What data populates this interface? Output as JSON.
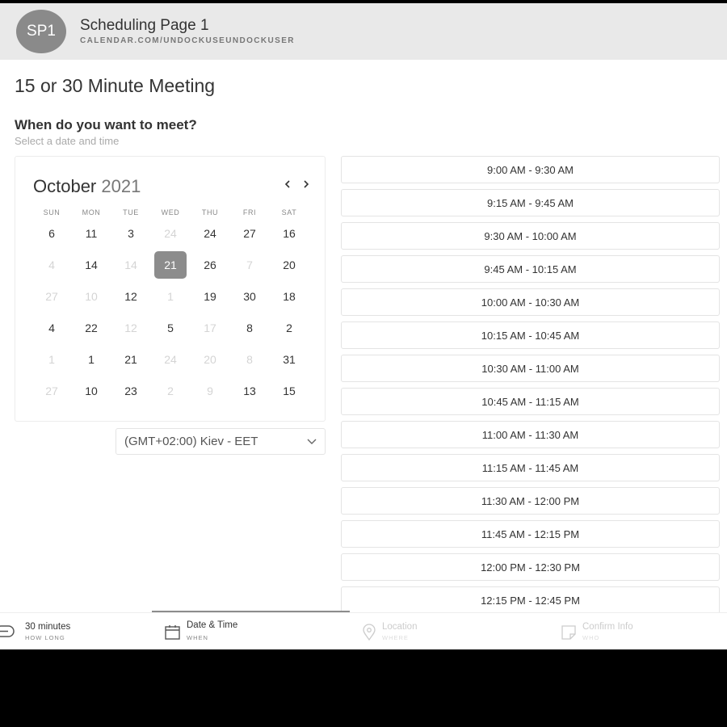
{
  "header": {
    "avatar_initials": "SP1",
    "page_name": "Scheduling Page 1",
    "page_url": "CALENDAR.COM/UNDOCKUSEUNDOCKUSER"
  },
  "meeting_title": "15 or 30 Minute Meeting",
  "question": "When do you want to meet?",
  "subtitle": "Select a date and time",
  "calendar": {
    "month": "October",
    "year": "2021",
    "weekdays": [
      "SUN",
      "MON",
      "TUE",
      "WED",
      "THU",
      "FRI",
      "SAT"
    ],
    "selected_day": "21",
    "weeks": [
      [
        {
          "d": "6",
          "on": true
        },
        {
          "d": "11",
          "on": true
        },
        {
          "d": "3",
          "on": true
        },
        {
          "d": "24",
          "on": false
        },
        {
          "d": "24",
          "on": true
        },
        {
          "d": "27",
          "on": true
        },
        {
          "d": "16",
          "on": true
        }
      ],
      [
        {
          "d": "4",
          "on": false
        },
        {
          "d": "14",
          "on": true
        },
        {
          "d": "14",
          "on": false
        },
        {
          "d": "21",
          "on": true,
          "selected": true
        },
        {
          "d": "26",
          "on": true
        },
        {
          "d": "7",
          "on": false
        },
        {
          "d": "20",
          "on": true
        }
      ],
      [
        {
          "d": "27",
          "on": false
        },
        {
          "d": "10",
          "on": false
        },
        {
          "d": "12",
          "on": true
        },
        {
          "d": "1",
          "on": false
        },
        {
          "d": "19",
          "on": true
        },
        {
          "d": "30",
          "on": true
        },
        {
          "d": "18",
          "on": true
        }
      ],
      [
        {
          "d": "4",
          "on": true
        },
        {
          "d": "22",
          "on": true
        },
        {
          "d": "12",
          "on": false
        },
        {
          "d": "5",
          "on": true
        },
        {
          "d": "17",
          "on": false
        },
        {
          "d": "8",
          "on": true
        },
        {
          "d": "2",
          "on": true
        }
      ],
      [
        {
          "d": "1",
          "on": false
        },
        {
          "d": "1",
          "on": true
        },
        {
          "d": "21",
          "on": true
        },
        {
          "d": "24",
          "on": false
        },
        {
          "d": "20",
          "on": false
        },
        {
          "d": "8",
          "on": false
        },
        {
          "d": "31",
          "on": true
        }
      ],
      [
        {
          "d": "27",
          "on": false
        },
        {
          "d": "10",
          "on": true
        },
        {
          "d": "23",
          "on": true
        },
        {
          "d": "2",
          "on": false
        },
        {
          "d": "9",
          "on": false
        },
        {
          "d": "13",
          "on": true
        },
        {
          "d": "15",
          "on": true
        }
      ]
    ]
  },
  "timezone": {
    "selected": "(GMT+02:00) Kiev - EET",
    "icon": "chevron-down-icon"
  },
  "time_slots": [
    "9:00 AM - 9:30 AM",
    "9:15 AM - 9:45 AM",
    "9:30 AM - 10:00 AM",
    "9:45 AM - 10:15 AM",
    "10:00 AM - 10:30 AM",
    "10:15 AM - 10:45 AM",
    "10:30 AM - 11:00 AM",
    "10:45 AM - 11:15 AM",
    "11:00 AM - 11:30 AM",
    "11:15 AM - 11:45 AM",
    "11:30 AM - 12:00 PM",
    "11:45 AM - 12:15 PM",
    "12:00 PM - 12:30 PM",
    "12:15 PM - 12:45 PM"
  ],
  "steps": [
    {
      "label": "30 minutes",
      "sub": "HOW LONG",
      "icon": "duration-icon",
      "state": "done"
    },
    {
      "label": "Date & Time",
      "sub": "WHEN",
      "icon": "calendar-icon",
      "state": "active"
    },
    {
      "label": "Location",
      "sub": "WHERE",
      "icon": "location-pin-icon",
      "state": "upcoming"
    },
    {
      "label": "Confirm Info",
      "sub": "WHO",
      "icon": "note-icon",
      "state": "upcoming"
    }
  ],
  "colors": {
    "header_bg": "#e9e9e9",
    "avatar_bg": "#8a8a8a",
    "selected_day_bg": "#8c8c8c",
    "border": "#e4e4e4",
    "text": "#333333",
    "muted_text": "#aaaaaa",
    "disabled_day": "#d4d4d4"
  }
}
